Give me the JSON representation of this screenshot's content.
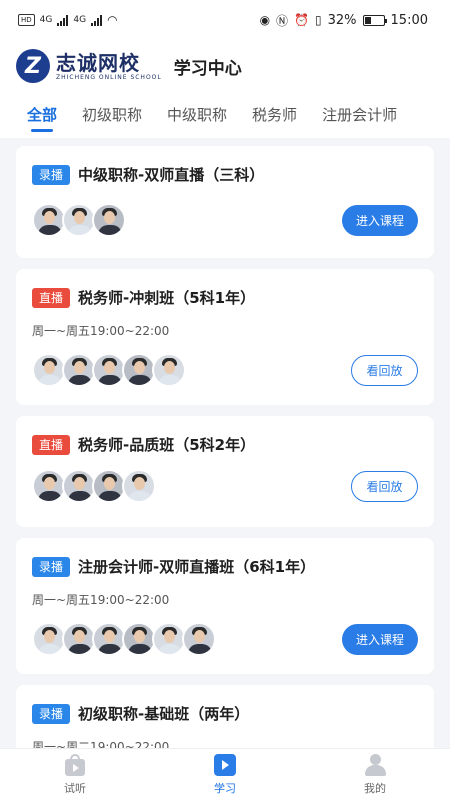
{
  "status_bar": {
    "network_left": "4G",
    "network_right": "4G",
    "battery": "32%",
    "time": "15:00"
  },
  "header": {
    "logo_mark": "Z",
    "logo_cn": "志诚网校",
    "logo_en": "ZHICHENG ONLINE SCHOOL",
    "title": "学习中心"
  },
  "tabs": [
    {
      "label": "全部",
      "active": true
    },
    {
      "label": "初级职称",
      "active": false
    },
    {
      "label": "中级职称",
      "active": false
    },
    {
      "label": "税务师",
      "active": false
    },
    {
      "label": "注册会计师",
      "active": false
    }
  ],
  "courses": [
    {
      "badge": "录播",
      "badge_type": "rec",
      "title": "中级职称-双师直播（三科）",
      "time": "",
      "teachers": 3,
      "button": "进入课程",
      "button_style": "primary"
    },
    {
      "badge": "直播",
      "badge_type": "live",
      "title": "税务师-冲刺班（5科1年）",
      "time": "周一~周五19:00~22:00",
      "teachers": 5,
      "button": "看回放",
      "button_style": "outline"
    },
    {
      "badge": "直播",
      "badge_type": "live",
      "title": "税务师-品质班（5科2年）",
      "time": "",
      "teachers": 4,
      "button": "看回放",
      "button_style": "outline"
    },
    {
      "badge": "录播",
      "badge_type": "rec",
      "title": "注册会计师-双师直播班（6科1年）",
      "time": "周一~周五19:00~22:00",
      "teachers": 6,
      "button": "进入课程",
      "button_style": "primary"
    },
    {
      "badge": "录播",
      "badge_type": "rec",
      "title": "初级职称-基础班（两年）",
      "time": "周一~周二19:00~22:00",
      "teachers": 0,
      "button": "",
      "button_style": ""
    }
  ],
  "bottom_nav": [
    {
      "label": "试听",
      "icon": "trial-bag-icon",
      "active": false
    },
    {
      "label": "学习",
      "icon": "study-play-icon",
      "active": true
    },
    {
      "label": "我的",
      "icon": "user-icon",
      "active": false
    }
  ],
  "colors": {
    "accent": "#2a7ce6",
    "live_badge": "#e94b3c",
    "rec_badge": "#2a86e8",
    "background": "#f3f5f8"
  }
}
